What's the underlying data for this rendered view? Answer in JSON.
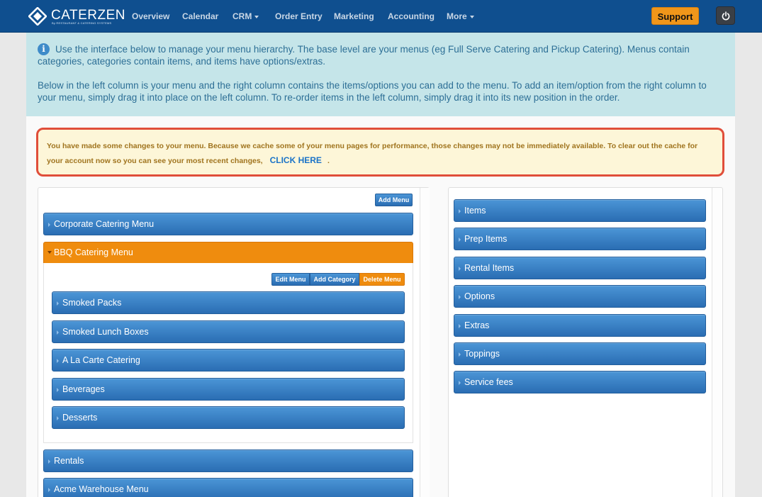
{
  "brand": {
    "name": "CATERZEN",
    "tagline": "By RESTAURANT & CATERING SYSTEMS"
  },
  "nav": {
    "items": [
      "Overview",
      "Calendar",
      "CRM",
      "Order Entry",
      "Marketing",
      "Accounting",
      "More"
    ],
    "support_label": "Support"
  },
  "icons": {
    "info": "info-circle-icon",
    "power": "power-icon"
  },
  "colors": {
    "nav": "#0f4f8f",
    "accent": "#ef8c0e",
    "info_bg": "#c5e5e9",
    "warn_bg": "#fdf6d8",
    "warn_border": "#e04e3a"
  },
  "info": {
    "icon_glyph": "i",
    "p1": "Use the interface below to manage your menu hierarchy. The base level are your menus (eg Full Serve Catering and Pickup Catering). Menus contain categories, categories contain items, and items have options/extras.",
    "p2": "Below in the left column is your menu and the right column contains the items/options you can add to the menu. To add an item/option from the right column to your menu, simply drag it into place on the left column. To re-order items in the left column, simply drag it into its new position in the order."
  },
  "warning": {
    "text": "You have made some changes to your menu. Because we cache some of your menu pages for performance, those changes may not be immediately available. To clear out the cache for your account now so you can see your most recent changes,",
    "link": "CLICK HERE",
    "suffix": "."
  },
  "left": {
    "add_menu_label": "Add Menu",
    "menus": [
      "Corporate Catering Menu",
      "BBQ Catering Menu",
      "Rentals",
      "Acme Warehouse Menu"
    ],
    "open_menu": {
      "edit_label": "Edit Menu",
      "add_category_label": "Add Category",
      "delete_label": "Delete Menu",
      "categories": [
        "Smoked Packs",
        "Smoked Lunch Boxes",
        "A La Carte Catering",
        "Beverages",
        "Desserts"
      ]
    }
  },
  "right": {
    "groups": [
      "Items",
      "Prep Items",
      "Rental Items",
      "Options",
      "Extras",
      "Toppings",
      "Service fees"
    ]
  }
}
